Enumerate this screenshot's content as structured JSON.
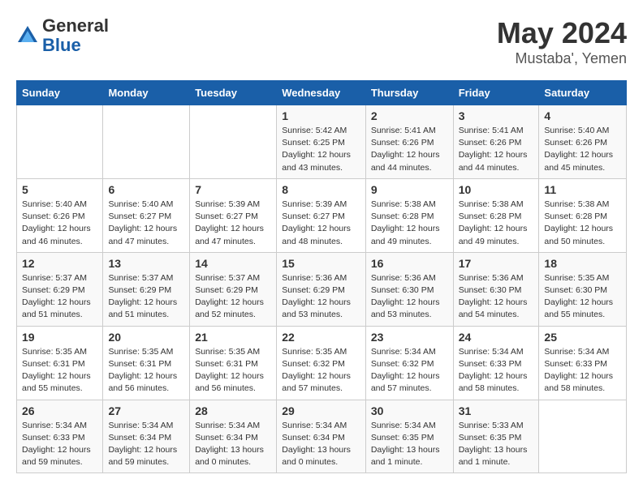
{
  "header": {
    "logo_general": "General",
    "logo_blue": "Blue",
    "title": "May 2024",
    "subtitle": "Mustaba', Yemen"
  },
  "days_of_week": [
    "Sunday",
    "Monday",
    "Tuesday",
    "Wednesday",
    "Thursday",
    "Friday",
    "Saturday"
  ],
  "weeks": [
    [
      {
        "num": "",
        "info": ""
      },
      {
        "num": "",
        "info": ""
      },
      {
        "num": "",
        "info": ""
      },
      {
        "num": "1",
        "info": "Sunrise: 5:42 AM\nSunset: 6:25 PM\nDaylight: 12 hours\nand 43 minutes."
      },
      {
        "num": "2",
        "info": "Sunrise: 5:41 AM\nSunset: 6:26 PM\nDaylight: 12 hours\nand 44 minutes."
      },
      {
        "num": "3",
        "info": "Sunrise: 5:41 AM\nSunset: 6:26 PM\nDaylight: 12 hours\nand 44 minutes."
      },
      {
        "num": "4",
        "info": "Sunrise: 5:40 AM\nSunset: 6:26 PM\nDaylight: 12 hours\nand 45 minutes."
      }
    ],
    [
      {
        "num": "5",
        "info": "Sunrise: 5:40 AM\nSunset: 6:26 PM\nDaylight: 12 hours\nand 46 minutes."
      },
      {
        "num": "6",
        "info": "Sunrise: 5:40 AM\nSunset: 6:27 PM\nDaylight: 12 hours\nand 47 minutes."
      },
      {
        "num": "7",
        "info": "Sunrise: 5:39 AM\nSunset: 6:27 PM\nDaylight: 12 hours\nand 47 minutes."
      },
      {
        "num": "8",
        "info": "Sunrise: 5:39 AM\nSunset: 6:27 PM\nDaylight: 12 hours\nand 48 minutes."
      },
      {
        "num": "9",
        "info": "Sunrise: 5:38 AM\nSunset: 6:28 PM\nDaylight: 12 hours\nand 49 minutes."
      },
      {
        "num": "10",
        "info": "Sunrise: 5:38 AM\nSunset: 6:28 PM\nDaylight: 12 hours\nand 49 minutes."
      },
      {
        "num": "11",
        "info": "Sunrise: 5:38 AM\nSunset: 6:28 PM\nDaylight: 12 hours\nand 50 minutes."
      }
    ],
    [
      {
        "num": "12",
        "info": "Sunrise: 5:37 AM\nSunset: 6:29 PM\nDaylight: 12 hours\nand 51 minutes."
      },
      {
        "num": "13",
        "info": "Sunrise: 5:37 AM\nSunset: 6:29 PM\nDaylight: 12 hours\nand 51 minutes."
      },
      {
        "num": "14",
        "info": "Sunrise: 5:37 AM\nSunset: 6:29 PM\nDaylight: 12 hours\nand 52 minutes."
      },
      {
        "num": "15",
        "info": "Sunrise: 5:36 AM\nSunset: 6:29 PM\nDaylight: 12 hours\nand 53 minutes."
      },
      {
        "num": "16",
        "info": "Sunrise: 5:36 AM\nSunset: 6:30 PM\nDaylight: 12 hours\nand 53 minutes."
      },
      {
        "num": "17",
        "info": "Sunrise: 5:36 AM\nSunset: 6:30 PM\nDaylight: 12 hours\nand 54 minutes."
      },
      {
        "num": "18",
        "info": "Sunrise: 5:35 AM\nSunset: 6:30 PM\nDaylight: 12 hours\nand 55 minutes."
      }
    ],
    [
      {
        "num": "19",
        "info": "Sunrise: 5:35 AM\nSunset: 6:31 PM\nDaylight: 12 hours\nand 55 minutes."
      },
      {
        "num": "20",
        "info": "Sunrise: 5:35 AM\nSunset: 6:31 PM\nDaylight: 12 hours\nand 56 minutes."
      },
      {
        "num": "21",
        "info": "Sunrise: 5:35 AM\nSunset: 6:31 PM\nDaylight: 12 hours\nand 56 minutes."
      },
      {
        "num": "22",
        "info": "Sunrise: 5:35 AM\nSunset: 6:32 PM\nDaylight: 12 hours\nand 57 minutes."
      },
      {
        "num": "23",
        "info": "Sunrise: 5:34 AM\nSunset: 6:32 PM\nDaylight: 12 hours\nand 57 minutes."
      },
      {
        "num": "24",
        "info": "Sunrise: 5:34 AM\nSunset: 6:33 PM\nDaylight: 12 hours\nand 58 minutes."
      },
      {
        "num": "25",
        "info": "Sunrise: 5:34 AM\nSunset: 6:33 PM\nDaylight: 12 hours\nand 58 minutes."
      }
    ],
    [
      {
        "num": "26",
        "info": "Sunrise: 5:34 AM\nSunset: 6:33 PM\nDaylight: 12 hours\nand 59 minutes."
      },
      {
        "num": "27",
        "info": "Sunrise: 5:34 AM\nSunset: 6:34 PM\nDaylight: 12 hours\nand 59 minutes."
      },
      {
        "num": "28",
        "info": "Sunrise: 5:34 AM\nSunset: 6:34 PM\nDaylight: 13 hours\nand 0 minutes."
      },
      {
        "num": "29",
        "info": "Sunrise: 5:34 AM\nSunset: 6:34 PM\nDaylight: 13 hours\nand 0 minutes."
      },
      {
        "num": "30",
        "info": "Sunrise: 5:34 AM\nSunset: 6:35 PM\nDaylight: 13 hours\nand 1 minute."
      },
      {
        "num": "31",
        "info": "Sunrise: 5:33 AM\nSunset: 6:35 PM\nDaylight: 13 hours\nand 1 minute."
      },
      {
        "num": "",
        "info": ""
      }
    ]
  ]
}
